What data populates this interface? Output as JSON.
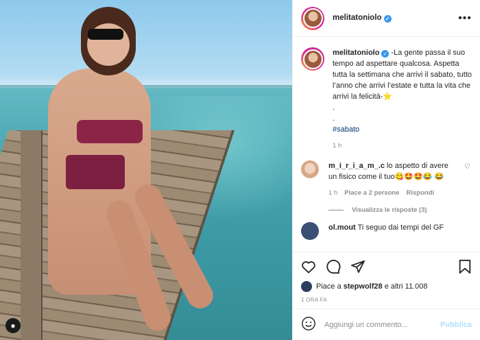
{
  "post": {
    "username": "melitatoniolo",
    "verified_badge": "✓"
  },
  "caption": {
    "username": "melitatoniolo",
    "text": "-La gente passa il suo tempo ad aspettare qualcosa. Aspetta tutta la settimana che arrivi il sabato, tutto l’anno che arrivi l’estate e tutta la vita che arrivi la felicità-⭐",
    "dots": ".",
    "hashtag": "#sabato",
    "time": "1 h"
  },
  "comments": [
    {
      "username": "m_i_r_i_a_m_.c",
      "text": "lo aspetto di avere un fisico come il tuo😋🤩🤩😂 😂",
      "time": "1 h",
      "likes": "Piace a 2 persone",
      "reply": "Rispondi",
      "view_replies": "Visualizza le risposte (3)"
    },
    {
      "username": "ol.mout",
      "text": "Ti seguo dai tempi del GF"
    }
  ],
  "likes": {
    "prefix": "Piace a",
    "user": "stepwolf28",
    "suffix": "e altri 11.008"
  },
  "date": "1 ORA FA",
  "add_comment": {
    "placeholder": "Aggiungi un commento...",
    "publish": "Pubblica"
  },
  "icons": [
    "heart-icon",
    "comment-icon",
    "share-icon",
    "bookmark-icon",
    "emoji-icon",
    "more-icon",
    "user-tag-icon"
  ],
  "colors": {
    "verified": "#3897f0",
    "link": "#00376b",
    "muted": "#8e8e8e",
    "publish": "#b2dffc"
  }
}
